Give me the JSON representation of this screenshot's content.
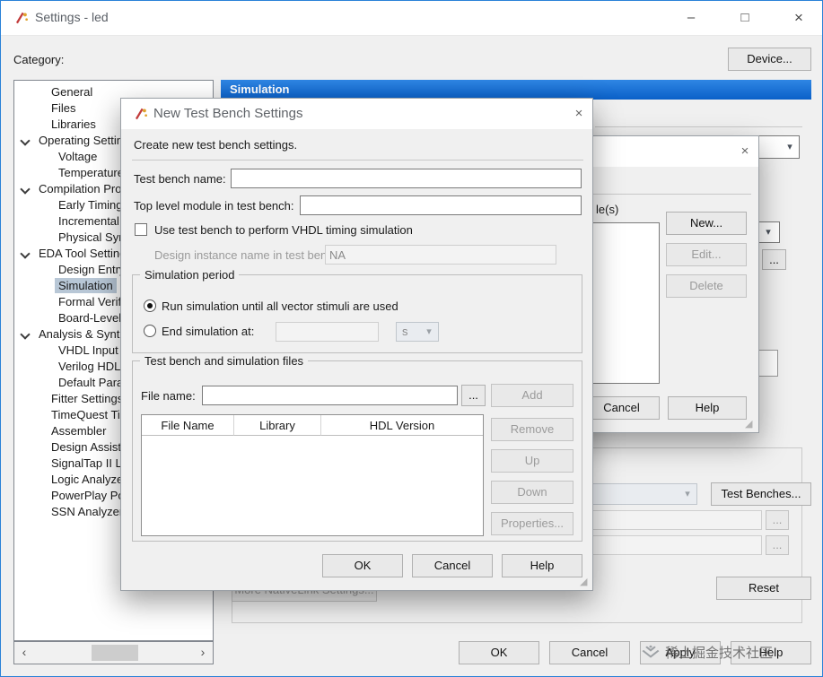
{
  "window": {
    "title": "Settings - led"
  },
  "icons": {
    "dropdown": "▾",
    "close": "×",
    "minimize": "–",
    "maximize": "□",
    "scroll_left": "‹",
    "scroll_right": "›",
    "resize_grip": "◢"
  },
  "topbar": {
    "category_label": "Category:",
    "device_button": "Device..."
  },
  "tree": {
    "items": [
      {
        "label": "General"
      },
      {
        "label": "Files"
      },
      {
        "label": "Libraries"
      },
      {
        "label": "Operating Settings and Conditions"
      },
      {
        "label": "Voltage"
      },
      {
        "label": "Temperature"
      },
      {
        "label": "Compilation Process Settings"
      },
      {
        "label": "Early Timing Estimate"
      },
      {
        "label": "Incremental Compilation"
      },
      {
        "label": "Physical Synthesis Optimizations"
      },
      {
        "label": "EDA Tool Settings"
      },
      {
        "label": "Design Entry/Synthesis"
      },
      {
        "label": "Simulation"
      },
      {
        "label": "Formal Verification"
      },
      {
        "label": "Board-Level"
      },
      {
        "label": "Analysis & Synthesis Settings"
      },
      {
        "label": "VHDL Input"
      },
      {
        "label": "Verilog HDL Input"
      },
      {
        "label": "Default Parameters"
      },
      {
        "label": "Fitter Settings"
      },
      {
        "label": "TimeQuest Timing Analyzer"
      },
      {
        "label": "Assembler"
      },
      {
        "label": "Design Assistant"
      },
      {
        "label": "SignalTap II Logic Analyzer"
      },
      {
        "label": "Logic Analyzer Interface"
      },
      {
        "label": "PowerPlay Power Analyzer Settings"
      },
      {
        "label": "SSN Analyzer"
      }
    ]
  },
  "page": {
    "section_header": "Simulation",
    "test_benches_button": "Test Benches...",
    "reset_button": "Reset",
    "more_nativelink_button": "More NativeLink Settings...",
    "browse": "...",
    "footer": {
      "ok": "OK",
      "cancel": "Cancel",
      "apply": "Apply",
      "help": "Help"
    }
  },
  "mid_dialog": {
    "label_fragment": "le(s)",
    "new_button": "New...",
    "edit_button": "Edit...",
    "delete_button": "Delete",
    "cancel_button": "Cancel",
    "help_button": "Help"
  },
  "tb_dialog": {
    "title": "New Test Bench Settings",
    "intro": "Create new test bench settings.",
    "name_label": "Test bench name:",
    "module_label": "Top level module in test bench:",
    "vhdl_checkbox_label": "Use test bench to perform VHDL timing simulation",
    "instance_label": "Design instance name in test bench:",
    "instance_value": "NA",
    "sim_period_group": "Simulation period",
    "radio_run_all": "Run simulation until all vector stimuli are used",
    "radio_end_at": "End simulation at:",
    "unit_value": "s",
    "files_group": "Test bench and simulation files",
    "file_name_label": "File name:",
    "browse_button": "...",
    "add_button": "Add",
    "table_headers": [
      "File Name",
      "Library",
      "HDL Version"
    ],
    "remove_button": "Remove",
    "up_button": "Up",
    "down_button": "Down",
    "properties_button": "Properties...",
    "ok": "OK",
    "cancel": "Cancel",
    "help": "Help"
  },
  "watermark": {
    "text": "稀土掘金技术社区"
  }
}
